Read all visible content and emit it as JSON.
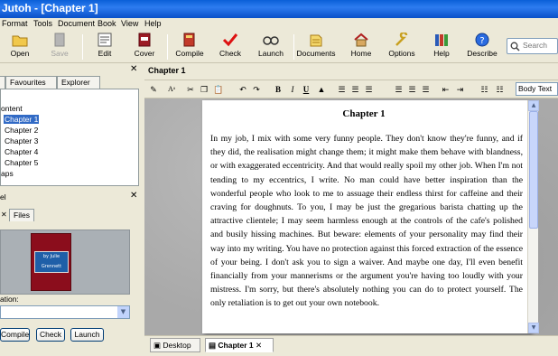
{
  "window": {
    "title": "Jutoh - [Chapter 1]"
  },
  "menu": [
    "Format",
    "Tools",
    "Document",
    "Book",
    "View",
    "Help"
  ],
  "toolbar": {
    "open": "Open",
    "save": "Save",
    "edit": "Edit",
    "cover": "Cover",
    "compile": "Compile",
    "check": "Check",
    "launch": "Launch",
    "documents": "Documents",
    "home": "Home",
    "options": "Options",
    "help": "Help",
    "describe": "Describe"
  },
  "search": {
    "placeholder": "Search"
  },
  "left_top": {
    "tabs": [
      "Favourites",
      "Explorer"
    ],
    "tree": {
      "content_label": "ontent",
      "chapters": [
        "Chapter 1",
        "Chapter 2",
        "Chapter 3",
        "Chapter 4",
        "Chapter 5"
      ],
      "maps_label": "aps"
    }
  },
  "left_bottom": {
    "header": "el",
    "tabs": [
      "Files"
    ],
    "cover_text": "by Julie Grennett",
    "location_label": "ation:",
    "buttons": {
      "compile": "Compile",
      "check": "Check",
      "launch": "Launch"
    }
  },
  "document": {
    "tab_title": "Chapter 1",
    "style": "Body Text",
    "heading": "Chapter 1",
    "body": "In my job, I mix with some very funny people. They don't know they're funny, and if they did, the realisation might change them; it might make them behave with blandness, or with exaggerated eccentricity. And that would really spoil my other job. When I'm not tending to my eccentrics, I write. No man could have better inspiration than the wonderful people who look to me to assuage their endless thirst for caffeine and their craving for doughnuts. To you, I may be just the gregarious barista chatting up the attractive clientele; I may seem harmless enough at the controls of the cafe's polished and busily hissing machines. But beware: elements of your personality may find their way into my writing. You have no protection against this forced extraction of the essence of your being. I don't ask you to sign a waiver. And maybe one day, I'll even benefit financially from your mannerisms or the argument you're having too loudly with your mistress. I'm sorry, but there's absolutely nothing you can do to protect yourself. The only retaliation is to get out your own notebook."
  },
  "bottom_tabs": [
    "Desktop",
    "Chapter 1"
  ]
}
